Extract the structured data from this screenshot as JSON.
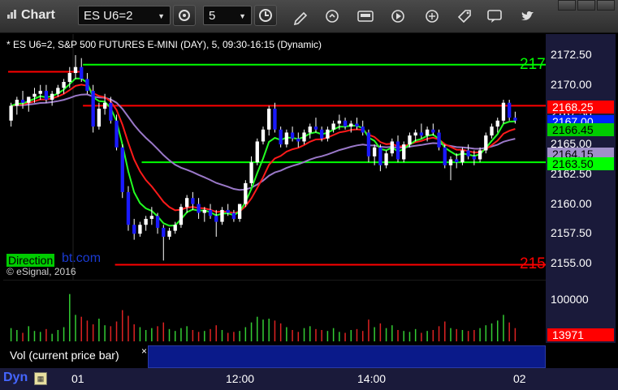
{
  "window": {
    "title": "Chart",
    "controls": [
      "restore-icon",
      "maximize-icon",
      "close-icon"
    ]
  },
  "toolbar": {
    "symbol": "ES U6=2",
    "interval": "5",
    "icons": [
      "settings-icon",
      "clock-icon",
      "draw-pencil-icon",
      "refresh-icon",
      "quote-get-icon",
      "play-icon",
      "link-icon",
      "tag-icon",
      "comment-icon",
      "twitter-icon"
    ]
  },
  "chart_header": "* ES U6=2, S&P 500 FUTURES E-MINI (DAY), 5, 09:30-16:15 (Dynamic)",
  "price_axis": {
    "ticks": [
      "2172.50",
      "2170.00",
      "2167.50",
      "2165.00",
      "2162.50",
      "2160.00",
      "2157.50",
      "2155.00"
    ],
    "tags": [
      {
        "text": "2168.25",
        "bg": "#ff0000",
        "fg": "#ffffff",
        "value": 2168.25
      },
      {
        "text": "2167.00",
        "bg": "#0022ff",
        "fg": "#ffffff",
        "value": 2167.0
      },
      {
        "text": "2166.45",
        "bg": "#00cc00",
        "fg": "#000000",
        "value": 2166.45
      },
      {
        "text": "2164.15",
        "bg": "#a090c8",
        "fg": "#000000",
        "value": 2164.15
      },
      {
        "text": "2163.50",
        "bg": "#00ff00",
        "fg": "#000000",
        "value": 2163.5
      }
    ],
    "cut_labels": [
      {
        "text": "217",
        "color": "#00ff00",
        "value": 2171.7
      },
      {
        "text": "215",
        "color": "#ff0000",
        "value": 2154.9
      }
    ]
  },
  "overlay": {
    "direction_badge": "Direction",
    "direction_rest": "bt.com",
    "copyright": "© eSignal, 2016"
  },
  "volume": {
    "legend": "Vol (current price bar)",
    "close": "×",
    "axis_ticks": [
      "100000"
    ],
    "current_tag": "13971",
    "current_tag_color": "#ff0000"
  },
  "time_axis": {
    "labels": [
      "01",
      "12:00",
      "14:00",
      "02"
    ],
    "dyn_label": "Dyn",
    "dyn_icon": "grid-icon"
  },
  "chart_data": {
    "type": "candlestick",
    "ylim": [
      2154,
      2174
    ],
    "levels": [
      {
        "color": "#00ff00",
        "value": 2171.7,
        "from": 0.14
      },
      {
        "color": "#ff0000",
        "value": 2171.1,
        "from": 0.0,
        "to": 0.14
      },
      {
        "color": "#ff0000",
        "value": 2168.25,
        "from": 0.14
      },
      {
        "color": "#00ff00",
        "value": 2163.5,
        "from": 0.25
      },
      {
        "color": "#ff0000",
        "value": 2154.9,
        "from": 0.2
      }
    ],
    "candles": [
      [
        2167.0,
        2168.5,
        2166.5,
        2168.25
      ],
      [
        2168.25,
        2169.0,
        2167.5,
        2168.75
      ],
      [
        2168.75,
        2169.5,
        2168.0,
        2168.5
      ],
      [
        2168.5,
        2169.0,
        2167.75,
        2169.0
      ],
      [
        2169.0,
        2169.75,
        2168.5,
        2169.25
      ],
      [
        2169.25,
        2170.0,
        2168.75,
        2169.5
      ],
      [
        2169.5,
        2170.0,
        2168.5,
        2168.75
      ],
      [
        2168.75,
        2169.5,
        2168.25,
        2169.25
      ],
      [
        2169.25,
        2170.0,
        2169.0,
        2169.75
      ],
      [
        2169.75,
        2170.5,
        2169.25,
        2170.25
      ],
      [
        2170.25,
        2171.5,
        2169.75,
        2171.0
      ],
      [
        2171.0,
        2172.5,
        2170.5,
        2171.5
      ],
      [
        2171.5,
        2172.25,
        2170.25,
        2170.5
      ],
      [
        2170.5,
        2171.0,
        2169.25,
        2169.5
      ],
      [
        2169.5,
        2170.0,
        2166.0,
        2166.5
      ],
      [
        2166.5,
        2168.5,
        2166.25,
        2168.0
      ],
      [
        2168.0,
        2169.25,
        2167.5,
        2168.5
      ],
      [
        2168.5,
        2169.0,
        2166.75,
        2167.0
      ],
      [
        2167.0,
        2167.5,
        2164.5,
        2164.75
      ],
      [
        2164.75,
        2165.0,
        2160.5,
        2161.0
      ],
      [
        2161.0,
        2161.5,
        2157.75,
        2158.25
      ],
      [
        2158.25,
        2158.75,
        2157.0,
        2157.5
      ],
      [
        2157.5,
        2158.5,
        2157.25,
        2158.25
      ],
      [
        2158.25,
        2159.0,
        2157.75,
        2158.75
      ],
      [
        2158.75,
        2159.75,
        2158.25,
        2159.0
      ],
      [
        2159.0,
        2159.25,
        2157.5,
        2158.0
      ],
      [
        2158.0,
        2158.25,
        2155.25,
        2157.25
      ],
      [
        2157.25,
        2158.0,
        2157.0,
        2157.75
      ],
      [
        2157.75,
        2158.5,
        2157.5,
        2158.25
      ],
      [
        2158.25,
        2160.0,
        2158.0,
        2159.75
      ],
      [
        2159.75,
        2160.75,
        2159.25,
        2160.5
      ],
      [
        2160.5,
        2161.0,
        2159.5,
        2160.0
      ],
      [
        2160.0,
        2160.5,
        2158.75,
        2159.25
      ],
      [
        2159.25,
        2159.75,
        2158.5,
        2159.5
      ],
      [
        2159.5,
        2160.0,
        2158.75,
        2159.0
      ],
      [
        2159.0,
        2159.5,
        2157.25,
        2158.5
      ],
      [
        2158.5,
        2159.75,
        2158.25,
        2159.5
      ],
      [
        2159.5,
        2160.0,
        2159.0,
        2159.25
      ],
      [
        2159.25,
        2159.5,
        2158.5,
        2158.75
      ],
      [
        2158.75,
        2160.0,
        2158.5,
        2160.0
      ],
      [
        2160.0,
        2162.0,
        2159.75,
        2161.75
      ],
      [
        2161.75,
        2164.0,
        2161.5,
        2163.5
      ],
      [
        2163.5,
        2165.5,
        2163.25,
        2165.25
      ],
      [
        2165.25,
        2166.5,
        2165.0,
        2166.25
      ],
      [
        2166.25,
        2168.25,
        2165.75,
        2168.0
      ],
      [
        2168.0,
        2168.5,
        2166.0,
        2166.25
      ],
      [
        2166.25,
        2166.5,
        2164.75,
        2165.0
      ],
      [
        2165.0,
        2166.25,
        2164.75,
        2166.0
      ],
      [
        2166.0,
        2166.5,
        2165.25,
        2165.5
      ],
      [
        2165.5,
        2166.0,
        2164.75,
        2165.25
      ],
      [
        2165.25,
        2166.25,
        2165.0,
        2166.0
      ],
      [
        2166.0,
        2166.75,
        2165.5,
        2166.5
      ],
      [
        2166.5,
        2167.25,
        2166.0,
        2166.25
      ],
      [
        2166.25,
        2166.5,
        2165.25,
        2165.5
      ],
      [
        2165.5,
        2166.5,
        2165.25,
        2166.25
      ],
      [
        2166.25,
        2167.0,
        2166.0,
        2166.75
      ],
      [
        2166.75,
        2167.5,
        2166.25,
        2167.0
      ],
      [
        2167.0,
        2167.25,
        2166.25,
        2166.5
      ],
      [
        2166.5,
        2167.0,
        2166.0,
        2166.75
      ],
      [
        2166.75,
        2167.25,
        2166.25,
        2166.5
      ],
      [
        2166.5,
        2167.0,
        2165.75,
        2166.0
      ],
      [
        2166.0,
        2166.25,
        2163.5,
        2164.0
      ],
      [
        2164.0,
        2165.0,
        2163.25,
        2164.75
      ],
      [
        2164.75,
        2165.0,
        2162.75,
        2163.25
      ],
      [
        2163.25,
        2164.5,
        2163.0,
        2164.25
      ],
      [
        2164.25,
        2165.5,
        2164.0,
        2165.25
      ],
      [
        2165.25,
        2165.75,
        2163.5,
        2163.75
      ],
      [
        2163.75,
        2165.25,
        2163.5,
        2165.0
      ],
      [
        2165.0,
        2166.0,
        2164.75,
        2165.75
      ],
      [
        2165.75,
        2166.25,
        2165.25,
        2166.0
      ],
      [
        2166.0,
        2166.75,
        2165.5,
        2165.75
      ],
      [
        2165.75,
        2166.5,
        2165.25,
        2166.25
      ],
      [
        2166.25,
        2166.75,
        2165.75,
        2166.0
      ],
      [
        2166.0,
        2166.25,
        2164.5,
        2164.75
      ],
      [
        2164.75,
        2165.0,
        2163.0,
        2163.25
      ],
      [
        2163.25,
        2164.0,
        2162.0,
        2163.75
      ],
      [
        2163.75,
        2164.25,
        2163.0,
        2163.5
      ],
      [
        2163.5,
        2164.75,
        2163.25,
        2164.5
      ],
      [
        2164.5,
        2165.0,
        2163.75,
        2164.0
      ],
      [
        2164.0,
        2164.5,
        2163.25,
        2163.75
      ],
      [
        2163.75,
        2164.75,
        2163.5,
        2164.5
      ],
      [
        2164.5,
        2166.0,
        2164.25,
        2165.75
      ],
      [
        2165.75,
        2166.75,
        2165.5,
        2166.5
      ],
      [
        2166.5,
        2167.25,
        2166.0,
        2167.0
      ],
      [
        2167.0,
        2168.75,
        2166.75,
        2168.5
      ],
      [
        2168.5,
        2168.75,
        2167.0,
        2167.25
      ],
      [
        2167.25,
        2167.75,
        2166.75,
        2167.0
      ]
    ],
    "volumes": [
      14,
      12,
      9,
      16,
      11,
      10,
      13,
      8,
      12,
      15,
      50,
      28,
      26,
      22,
      18,
      24,
      17,
      16,
      21,
      33,
      27,
      18,
      15,
      12,
      14,
      16,
      20,
      13,
      11,
      14,
      16,
      12,
      10,
      11,
      13,
      17,
      12,
      9,
      10,
      11,
      15,
      20,
      26,
      23,
      24,
      22,
      19,
      15,
      12,
      10,
      14,
      16,
      13,
      12,
      11,
      14,
      10,
      9,
      12,
      13,
      11,
      23,
      15,
      19,
      14,
      17,
      12,
      11,
      10,
      13,
      9,
      11,
      12,
      16,
      21,
      14,
      13,
      12,
      11,
      12,
      14,
      17,
      19,
      22,
      28,
      20,
      14
    ]
  }
}
